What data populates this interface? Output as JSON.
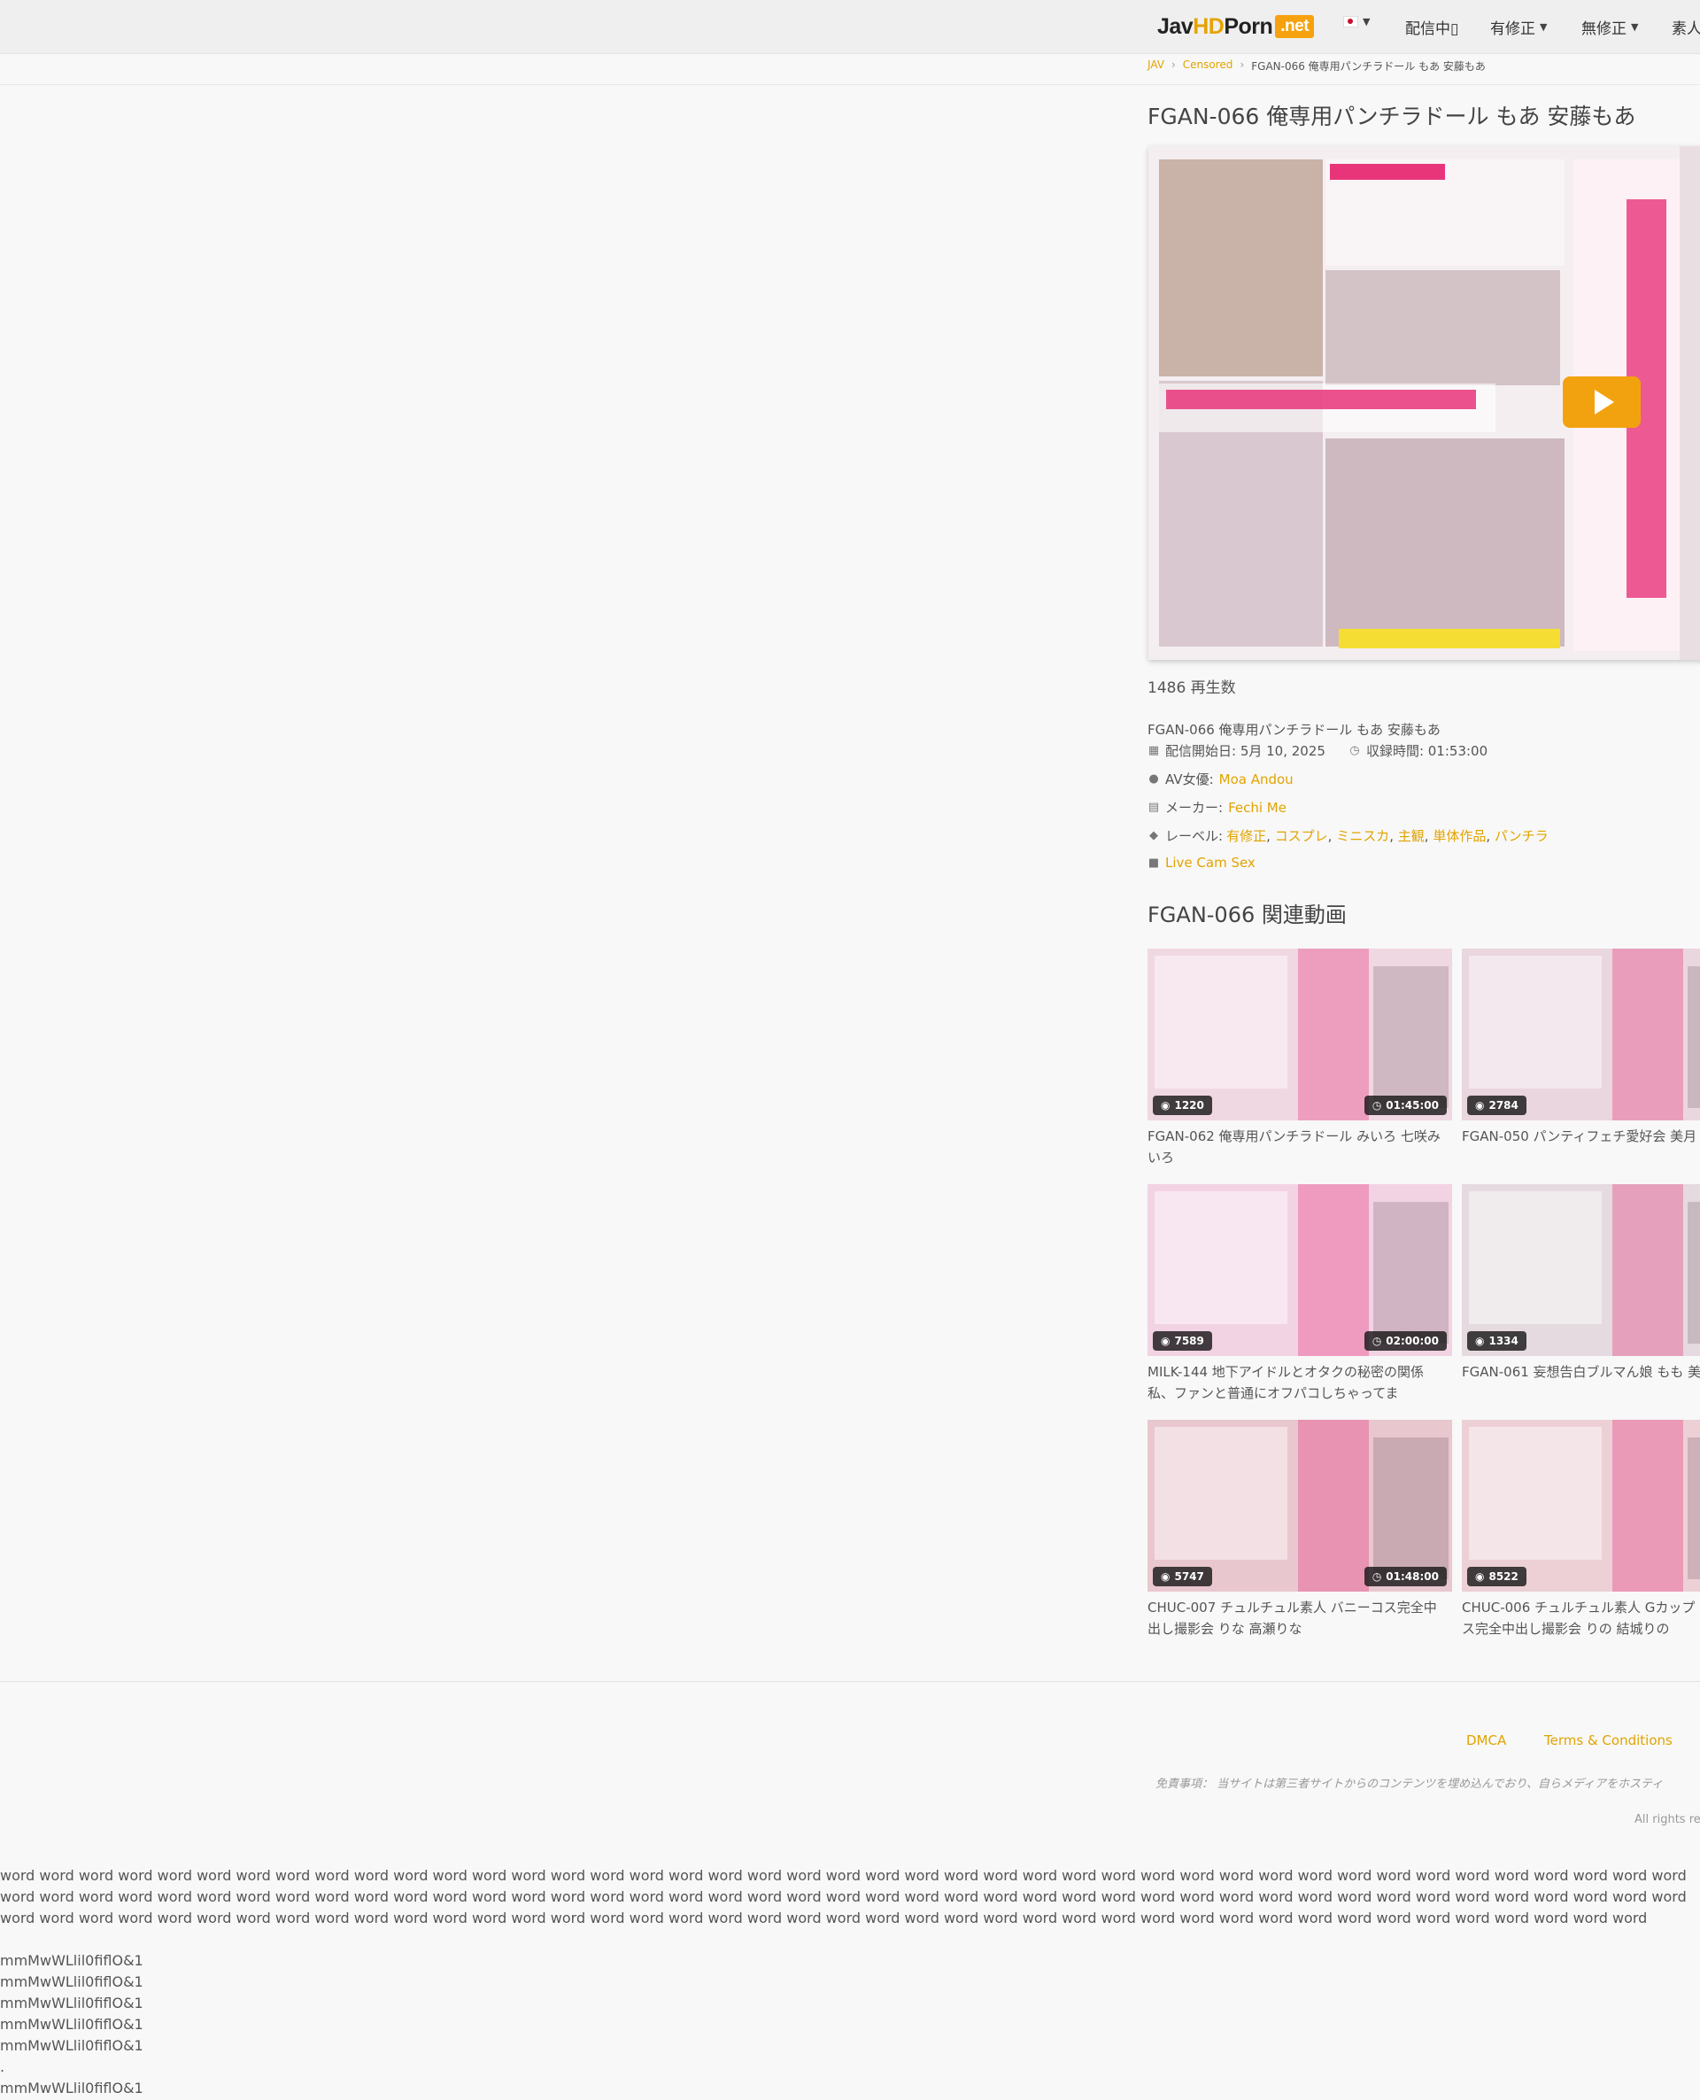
{
  "header": {
    "logo": {
      "part1": "Jav",
      "part2": "HD",
      "part3": "Porn",
      "part4": ".net"
    },
    "nav": [
      {
        "label": "配信中▯"
      },
      {
        "label": "有修正"
      },
      {
        "label": "無修正"
      },
      {
        "label": "素人"
      }
    ]
  },
  "breadcrumb": [
    "JAV",
    "Censored",
    "FGAN-066 俺専用パンチラドール もあ 安藤もあ"
  ],
  "video": {
    "title": "FGAN-066 俺専用パンチラドール もあ 安藤もあ",
    "views": "1486 再生数",
    "subtitle": "FGAN-066 俺専用パンチラドール もあ 安藤もあ",
    "release_label": "配信開始日: 5月 10, 2025",
    "duration_label": "収録時間: 01:53:00",
    "actress_label": "AV女優:",
    "actress": "Moa Andou",
    "maker_label": "メーカー:",
    "maker": "Fechi Me",
    "label_label": "レーベル:",
    "tags": [
      "有修正",
      "コスプレ",
      "ミニスカ",
      "主観",
      "単体作品",
      "パンチラ"
    ],
    "livecam": "Live Cam Sex"
  },
  "related": {
    "title": "FGAN-066 関連動画",
    "items": [
      {
        "views": "1220",
        "duration": "01:45:00",
        "caption1": "FGAN-062 俺専用パンチラドール みいろ 七咲み",
        "caption2": "いろ",
        "color": "#f0d8e2"
      },
      {
        "views": "2784",
        "duration": "",
        "caption1": "FGAN-050 パンティフェチ愛好会 美月",
        "caption2": "",
        "color": "#ead6de"
      },
      {
        "views": "7589",
        "duration": "02:00:00",
        "caption1": "MILK-144 地下アイドルとオタクの秘密の関係",
        "caption2": "私、ファンと普通にオフパコしちゃってま",
        "color": "#f2d3e3"
      },
      {
        "views": "1334",
        "duration": "",
        "caption1": "FGAN-061 妄想告白ブルマん娘 もも 美",
        "caption2": "",
        "color": "#e4dadf"
      },
      {
        "views": "5747",
        "duration": "01:48:00",
        "caption1": "CHUC-007 チュルチュル素人 バニーコス完全中",
        "caption2": "出し撮影会 りな 高瀬りな",
        "color": "#e9c7cf"
      },
      {
        "views": "8522",
        "duration": "",
        "caption1": "CHUC-006 チュルチュル素人 Gカップ",
        "caption2": "ス完全中出し撮影会 りの 結城りの",
        "color": "#ecd0d6"
      }
    ]
  },
  "footer": {
    "links": [
      "DMCA",
      "Terms & Conditions"
    ],
    "disclaimer": "免責事項： 当サイトは第三者サイトからのコンテンツを埋め込んでおり、自らメディアをホスティ",
    "rights": "All rights re"
  },
  "probe": {
    "words": "word word word word word word word word word word word word word word word word word word word word word word word word word word word word word word word word word word word word word word word word word word word word word word word word word word word word word word word word word word word word word word word word word word word word word word word word word word word word word word word word word word word word word word word word word word word word word word word word word word word word word word word word word word word word word word word word word word word word word word word word word word word word word word word word",
    "lines": [
      "mmMwWLlil0fiflO&1",
      "mmMwWLlil0fiflO&1",
      "mmMwWLlil0fiflO&1",
      "mmMwWLlil0fiflO&1",
      "mmMwWLlil0fiflO&1",
      ".",
      "mmMwWLlil0fiflO&1"
    ]
  },
  "colors": {
    "accent": "#e2a300",
    "brand_orange": "#f6a10e",
    "tag_link": "#e2a300"
  }
}
